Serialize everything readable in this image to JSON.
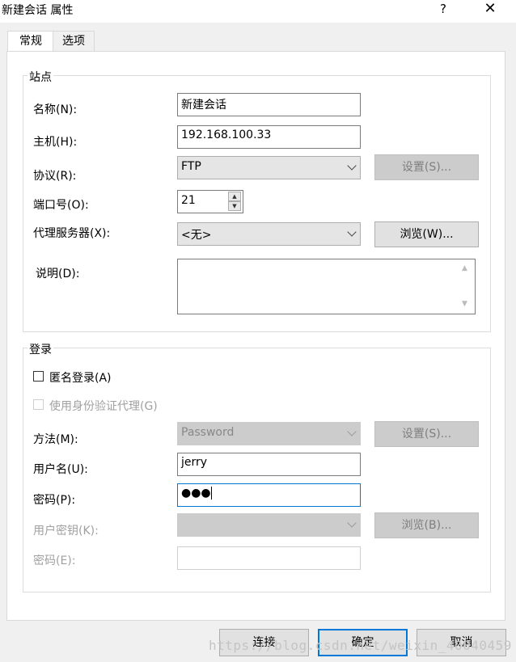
{
  "window": {
    "title": "新建会话 属性",
    "help_label": "?",
    "close_label": "✕"
  },
  "tabs": [
    {
      "label": "常规",
      "active": true
    },
    {
      "label": "选项",
      "active": false
    }
  ],
  "site": {
    "group_label": "站点",
    "name": {
      "label": "名称(N):",
      "value": "新建会话"
    },
    "host": {
      "label": "主机(H):",
      "value": "192.168.100.33"
    },
    "protocol": {
      "label": "协议(R):",
      "value": "FTP",
      "settings_label": "设置(S)..."
    },
    "port": {
      "label": "端口号(O):",
      "value": "21"
    },
    "proxy": {
      "label": "代理服务器(X):",
      "value": "<无>",
      "browse_label": "浏览(W)..."
    },
    "description": {
      "label": "说明(D):",
      "value": ""
    }
  },
  "login": {
    "group_label": "登录",
    "anonymous": {
      "label": "匿名登录(A)",
      "checked": false
    },
    "auth_agent": {
      "label": "使用身份验证代理(G)",
      "checked": false,
      "disabled": true
    },
    "method": {
      "label": "方法(M):",
      "value": "Password",
      "settings_label": "设置(S)..."
    },
    "username": {
      "label": "用户名(U):",
      "value": "jerry"
    },
    "password": {
      "label": "密码(P):",
      "value": "●●●"
    },
    "user_key": {
      "label": "用户密钥(K):",
      "value": "",
      "browse_label": "浏览(B)..."
    },
    "passphrase": {
      "label": "密码(E):",
      "value": ""
    }
  },
  "footer": {
    "connect_label": "连接",
    "ok_label": "确定",
    "cancel_label": "取消"
  },
  "watermark": "https://blog.csdn.net/weixin_40040459"
}
